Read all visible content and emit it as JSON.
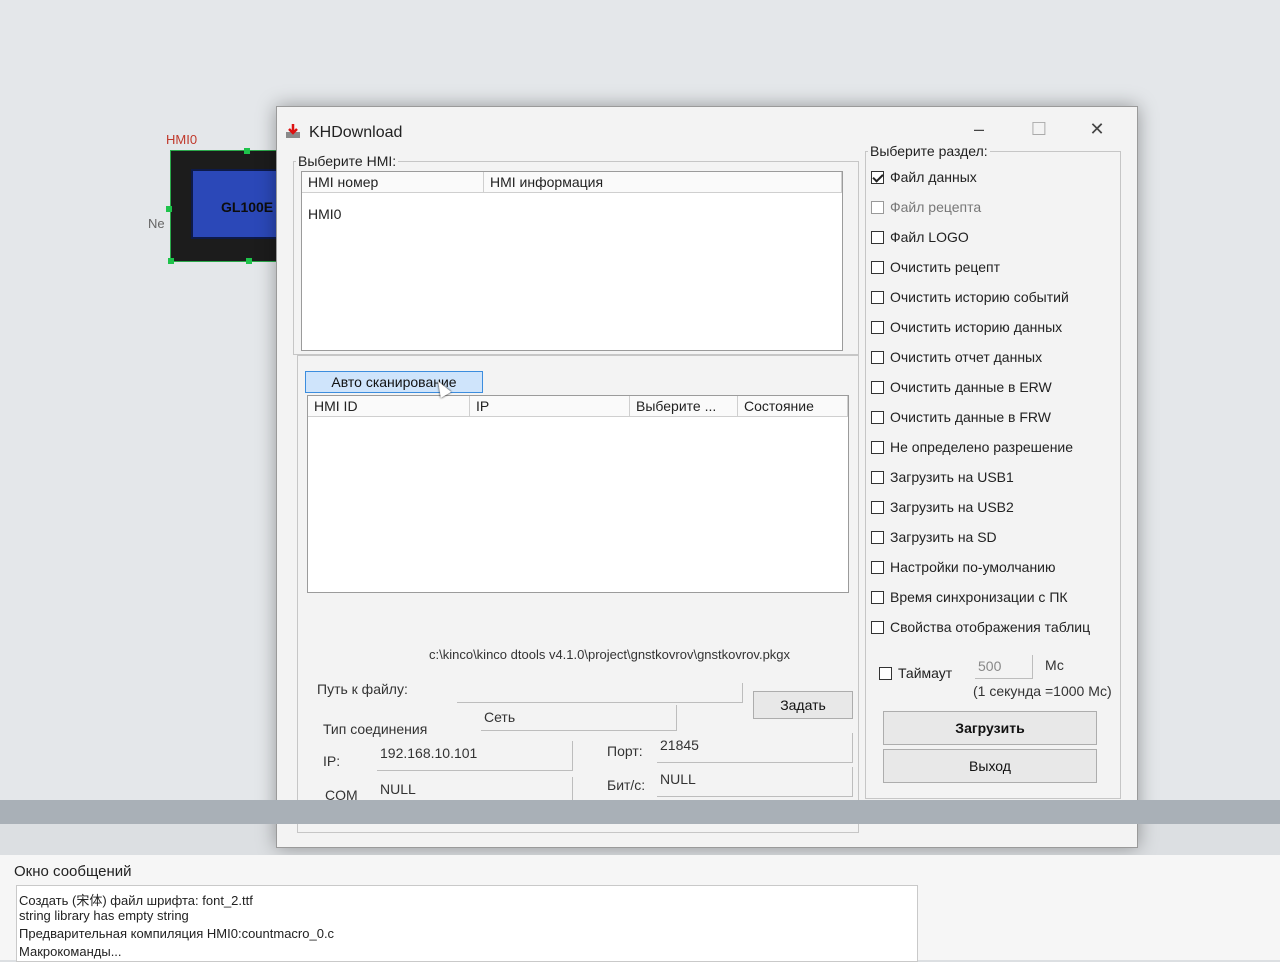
{
  "canvas": {
    "hmi_tag": "HMI0",
    "device_model": "GL100E",
    "net_label": "Ne"
  },
  "dialog": {
    "title": "KHDownload",
    "window_controls": {
      "minimize": "–",
      "maximize": "☐",
      "close": "✕"
    },
    "select_hmi": {
      "legend": "Выберите HMI:",
      "columns": [
        "HMI номер",
        "HMI информация"
      ],
      "rows": [
        [
          "HMI0",
          ""
        ]
      ]
    },
    "scan": {
      "button_label": "Авто сканирование",
      "columns": [
        "HMI ID",
        "IP",
        "Выберите ...",
        "Состояние"
      ]
    },
    "file_path_value": "c:\\kinco\\kinco dtools v4.1.0\\project\\gnstkovrov\\gnstkovrov.pkgx",
    "file_path_label": "Путь к файлу:",
    "set_button": "Задать",
    "connection_type_label": "Тип соединения",
    "connection_type_value": "Сеть",
    "ip_label": "IP:",
    "ip_value": "192.168.10.101",
    "port_label": "Порт:",
    "port_value": "21845",
    "com_label": "COM",
    "com_value": "NULL",
    "baud_label": "Бит/с:",
    "baud_value": "NULL",
    "section": {
      "legend": "Выберите раздел:",
      "items": [
        {
          "label": "Файл данных",
          "checked": true,
          "enabled": true
        },
        {
          "label": "Файл рецепта",
          "checked": false,
          "enabled": false
        },
        {
          "label": "Файл LOGO",
          "checked": false,
          "enabled": true
        },
        {
          "label": "Очистить рецепт",
          "checked": false,
          "enabled": true
        },
        {
          "label": "Очистить историю событий",
          "checked": false,
          "enabled": true
        },
        {
          "label": "Очистить историю данных",
          "checked": false,
          "enabled": true
        },
        {
          "label": "Очистить отчет данных",
          "checked": false,
          "enabled": true
        },
        {
          "label": "Очистить данные в ERW",
          "checked": false,
          "enabled": true
        },
        {
          "label": "Очистить данные в FRW",
          "checked": false,
          "enabled": true
        },
        {
          "label": "Не определено разрешение",
          "checked": false,
          "enabled": true
        },
        {
          "label": "Загрузить на USB1",
          "checked": false,
          "enabled": true
        },
        {
          "label": "Загрузить на USB2",
          "checked": false,
          "enabled": true
        },
        {
          "label": "Загрузить на SD",
          "checked": false,
          "enabled": true
        },
        {
          "label": "Настройки по-умолчанию",
          "checked": false,
          "enabled": true
        },
        {
          "label": "Время синхронизации с ПК",
          "checked": false,
          "enabled": true
        },
        {
          "label": "Свойства отображения таблиц",
          "checked": false,
          "enabled": true
        }
      ],
      "timeout_label": "Таймаут",
      "timeout_value": "500",
      "timeout_unit": "Мс",
      "timeout_hint": "(1 секунда =1000 Мс)"
    },
    "download_button": "Загрузить",
    "exit_button": "Выход"
  },
  "messages": {
    "title": "Окно сообщений",
    "lines": [
      "Создать (宋体) файл шрифта: font_2.ttf",
      "string library has empty string",
      "Предварительная компиляция HMI0:countmacro_0.c",
      "Макрокоманды..."
    ]
  },
  "colors": {
    "accent_button": "#cfe4fb",
    "hmi_screen": "#2b48b8",
    "selection_handle": "#1ec34b"
  }
}
